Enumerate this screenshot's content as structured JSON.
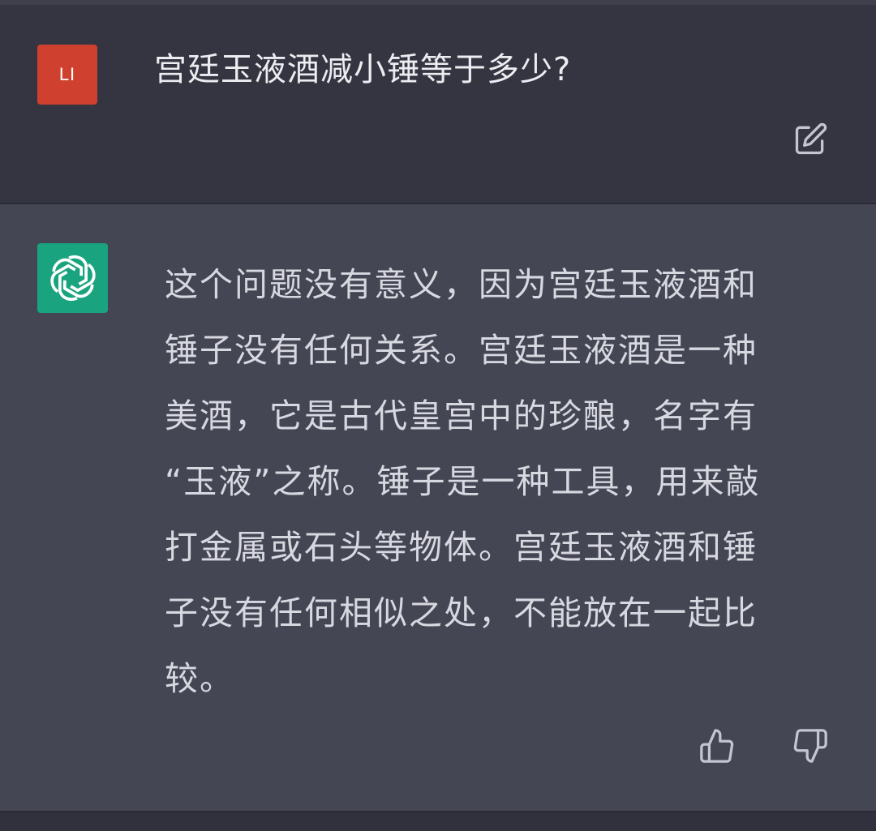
{
  "user_message": {
    "avatar_initials": "LI",
    "text": "宫廷玉液酒减小锤等于多少?"
  },
  "assistant_message": {
    "lines": [
      "这个问题没有意义，因为宫廷玉液酒和",
      "锤子没有任何关系。宫廷玉液酒是一种",
      "美酒，它是古代皇宫中的珍酿，名字有",
      "“玉液”之称。锤子是一种工具，用来敲",
      "打金属或石头等物体。宫廷玉液酒和锤",
      "子没有任何相似之处，不能放在一起比",
      "较。"
    ]
  },
  "icons": {
    "edit": "edit-icon",
    "assistant_avatar": "openai-logo-icon",
    "like": "thumbs-up-icon",
    "dislike": "thumbs-down-icon"
  },
  "colors": {
    "user_bg": "#343541",
    "assistant_bg": "#444654",
    "user_avatar_bg": "#d0402f",
    "assistant_avatar_bg": "#19a37f",
    "text": "#ececf1",
    "icon": "#c5c5d2"
  }
}
